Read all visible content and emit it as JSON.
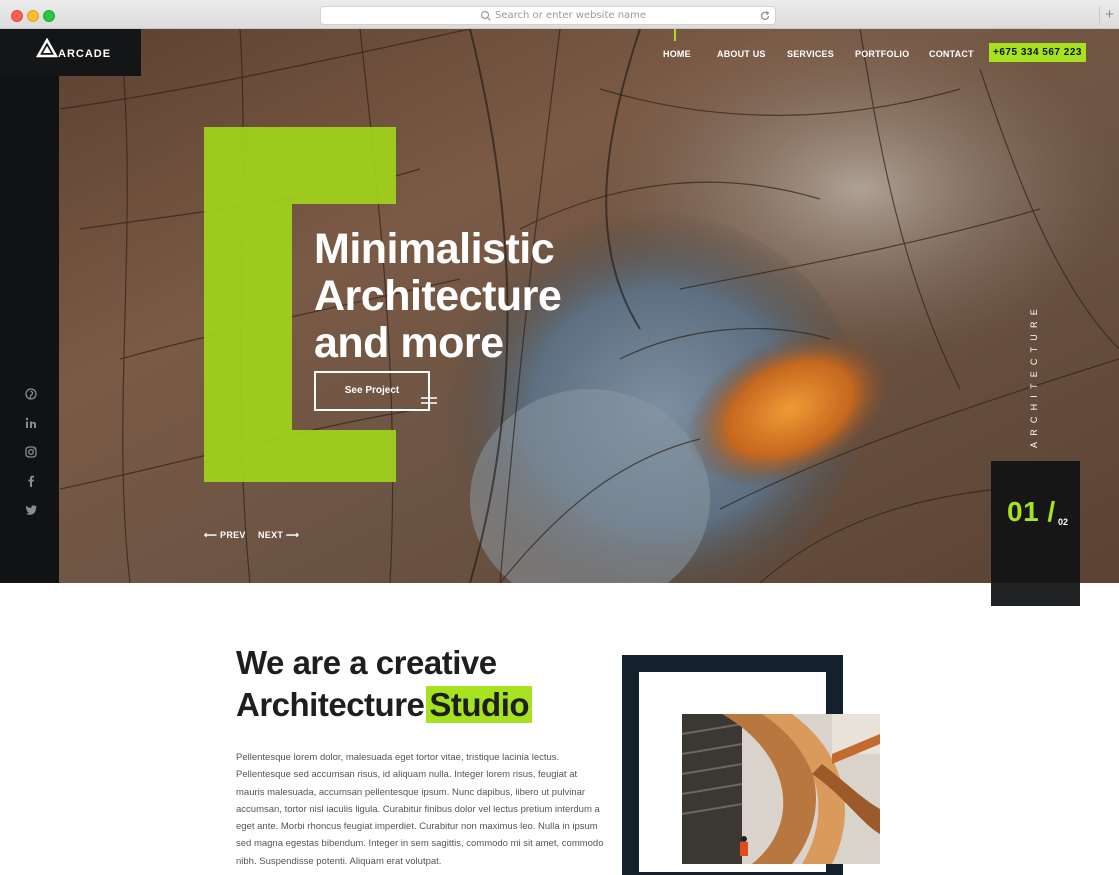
{
  "browser": {
    "url_placeholder": "Search or enter website name",
    "new_tab_label": "+"
  },
  "brand": {
    "name": "ARCADE",
    "accent_color": "#a6e21f",
    "dark_color": "#111214"
  },
  "nav": {
    "items": [
      "HOME",
      "ABOUT US",
      "SERVICES",
      "PORTFOLIO",
      "CONTACT"
    ],
    "active": "HOME",
    "phone": "+675 334 567 223"
  },
  "hero": {
    "headline": [
      "Minimalistic",
      "Architecture",
      "and more"
    ],
    "cta_label": "See Project",
    "prev_label": "PREV",
    "next_label": "NEXT",
    "vertical_label": "ARCHITECTURE",
    "slide_current": "01 /",
    "slide_total": "02"
  },
  "social": {
    "icons": [
      "pinterest-icon",
      "linkedin-icon",
      "instagram-icon",
      "facebook-icon",
      "twitter-icon"
    ]
  },
  "about": {
    "title_line1": "We are a creative",
    "title_line2": "Architecture",
    "title_highlight": "Studio",
    "body": "Pellentesque lorem dolor, malesuada eget tortor vitae, tristique lacinia lectus. Pellentesque sed accumsan risus, id aliquam nulla. Integer lorem risus, feugiat at mauris malesuada, accumsan pellentesque ipsum. Nunc dapibus, libero ut pulvinar accumsan, tortor nisl iaculis ligula. Curabitur finibus dolor vel lectus pretium interdum a eget ante. Morbi rhoncus feugiat imperdiet. Curabitur non maximus leo. Nulla in ipsum sed magna egestas bibendum. Integer in sem sagittis, commodo mi sit amet, commodo nibh. Suspendisse potenti. Aliquam erat volutpat."
  }
}
